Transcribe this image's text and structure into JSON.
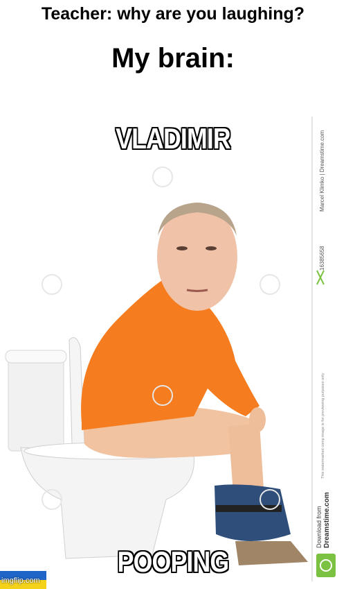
{
  "caption": {
    "line1": "Teacher: why are you laughing?",
    "line2": "My brain:"
  },
  "meme": {
    "top_text": "VLADIMIR",
    "bottom_text": "POOPING"
  },
  "watermark": {
    "id_text": "16385658",
    "credit_text": "Marcel Klimko | Dreamstime.com",
    "download_text": "Download from",
    "site_text": "Dreamstime.com",
    "notice_text": "This watermarked comp image is for previewing purposes only"
  },
  "footer": {
    "imgflip_label": "imgflip.com"
  },
  "colors": {
    "shirt": "#f57c1f",
    "skin": "#f3c6a6",
    "toilet": "#f2f2f2",
    "jeans": "#2f4f7a"
  }
}
